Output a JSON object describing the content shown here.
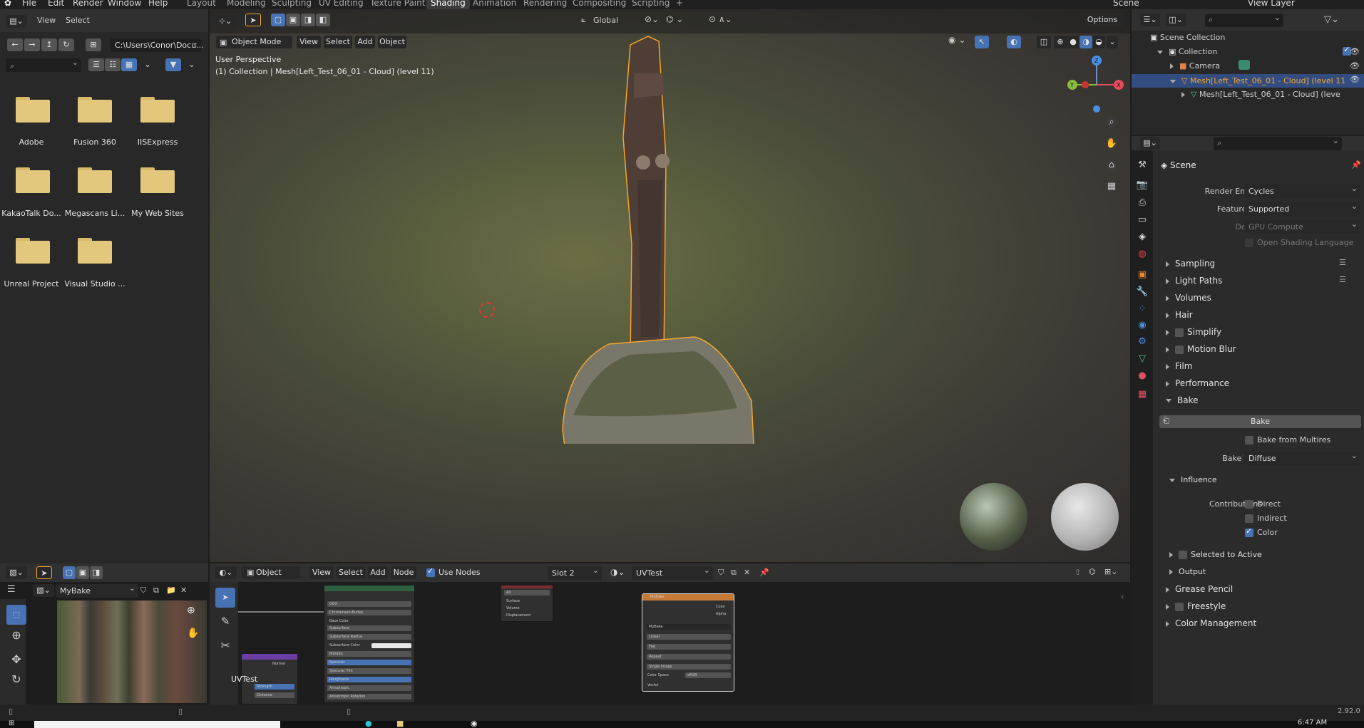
{
  "menu": {
    "file": "File",
    "edit": "Edit",
    "render": "Render",
    "window": "Window",
    "help": "Help"
  },
  "workspaces": [
    "Layout",
    "Modeling",
    "Sculpting",
    "UV Editing",
    "Texture Paint",
    "Shading",
    "Animation",
    "Rendering",
    "Compositing",
    "Scripting"
  ],
  "active_workspace": "Shading",
  "topright": {
    "scene": "Scene",
    "view_layer": "View Layer"
  },
  "filebrowser": {
    "menu_view": "View",
    "menu_select": "Select",
    "path": "C:\\Users\\Conor\\Docu...",
    "folders": [
      "Adobe",
      "Fusion 360",
      "IISExpress",
      "KakaoTalk Do...",
      "Megascans Li...",
      "My Web Sites",
      "Unreal Project",
      "Visual Studio ..."
    ]
  },
  "viewport": {
    "mode": "Object Mode",
    "view": "View",
    "select": "Select",
    "add": "Add",
    "object": "Object",
    "transform": "Global",
    "options": "Options",
    "info1": "User Perspective",
    "info2": "(1) Collection | Mesh[Left_Test_06_01 - Cloud] (level 11)"
  },
  "outliner": {
    "scene_collection": "Scene Collection",
    "collection": "Collection",
    "camera": "Camera",
    "mesh": "Mesh[Left_Test_06_01 - Cloud] (level 11",
    "mesh_data": "Mesh[Left_Test_06_01 - Cloud] (leve"
  },
  "properties": {
    "scene": "Scene",
    "render_engine_label": "Render Engine",
    "render_engine": "Cycles",
    "feature_set_label": "Feature Set",
    "feature_set": "Supported",
    "device_label": "Device",
    "device": "GPU Compute",
    "osl": "Open Shading Language",
    "sections": [
      "Sampling",
      "Light Paths",
      "Volumes",
      "Hair",
      "Simplify",
      "Motion Blur",
      "Film",
      "Performance",
      "Bake"
    ],
    "bake_button": "Bake",
    "bake_from_multires": "Bake from Multires",
    "bake_type_label": "Bake Type",
    "bake_type": "Diffuse",
    "influence": "Influence",
    "contributions": "Contributions",
    "direct": "Direct",
    "indirect": "Indirect",
    "color": "Color",
    "selected_to_active": "Selected to Active",
    "output": "Output",
    "after": [
      "Grease Pencil",
      "Freestyle",
      "Color Management"
    ]
  },
  "image_editor": {
    "image_name": "MyBake"
  },
  "node_editor": {
    "object": "Object",
    "view": "View",
    "select": "Select",
    "add": "Add",
    "node": "Node",
    "use_nodes": "Use Nodes",
    "slot": "Slot 2",
    "material": "UVTest",
    "uvtest_label": "UVTest",
    "node_mybake": "MyBake",
    "mybake_rows": [
      "Color",
      "Alpha"
    ],
    "mybake_opts": [
      "Linear",
      "Flat",
      "Repeat",
      "Single Image"
    ],
    "colorspace_label": "Color Space",
    "colorspace": "sRGB",
    "vector": "Vector",
    "bsdf_rows": [
      "GGX",
      "Christensen-Burley",
      "Base Color",
      "Subsurface",
      "Subsurface Radius",
      "Subsurface Color",
      "Metallic",
      "Specular",
      "Specular Tint",
      "Roughness",
      "Anisotropic",
      "Anisotropic Rotation"
    ],
    "bsdf_vals": [
      "0.000",
      "0.000",
      "0.500",
      "0.000",
      "0.500",
      "0.000",
      "0.000"
    ],
    "output_rows": [
      "All",
      "Surface",
      "Volume",
      "Displacement"
    ],
    "uv_rows": [
      "Normal",
      "Strength",
      "Distance"
    ]
  },
  "statusbar": {
    "version": "2.92.0"
  },
  "taskbar": {
    "time": "6:47 AM"
  },
  "colors": {
    "accent": "#4772b3",
    "select_orange": "#f5a631",
    "active_row": "#334d80"
  }
}
